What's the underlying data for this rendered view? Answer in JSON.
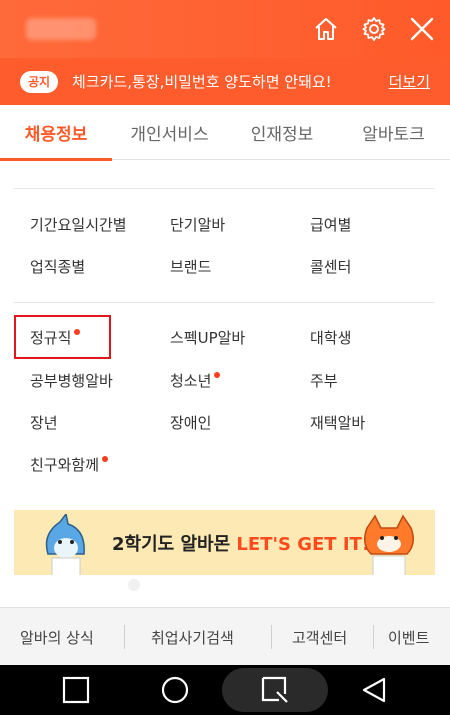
{
  "header": {
    "icons": [
      "home-icon",
      "gear-icon",
      "close-icon"
    ],
    "bg_color": "#ff5a2a"
  },
  "notice": {
    "badge": "공지",
    "text": "체크카드,통장,비밀번호 양도하면 안돼요!",
    "more": "더보기"
  },
  "tabs": [
    {
      "label": "채용정보",
      "active": true
    },
    {
      "label": "개인서비스",
      "active": false
    },
    {
      "label": "인재정보",
      "active": false
    },
    {
      "label": "알바토크",
      "active": false
    }
  ],
  "menu": {
    "group1": [
      "기간요일시간별",
      "단기알바",
      "급여별",
      "업직종별",
      "브랜드",
      "콜센터"
    ],
    "group2": [
      "정규직",
      "스펙UP알바",
      "대학생",
      "공부병행알바",
      "청소년",
      "주부",
      "장년",
      "장애인",
      "재택알바",
      "친구와함께"
    ],
    "new_dot_items": [
      "정규직",
      "청소년",
      "친구와함께"
    ]
  },
  "banner": {
    "text_main": "2학기도 알바몬 ",
    "text_accent": "LET'S GET IT!"
  },
  "footer": {
    "links": [
      "알바의 상식",
      "취업사기검색",
      "고객센터",
      "이벤트"
    ]
  },
  "navbar": {
    "icons": [
      "back-square-icon",
      "home-circle-icon",
      "recent-apps-icon",
      "back-triangle-icon"
    ]
  }
}
